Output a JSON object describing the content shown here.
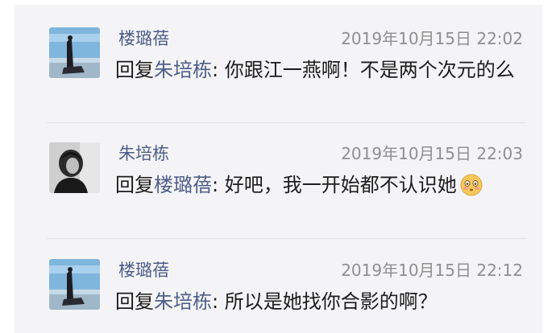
{
  "comments": [
    {
      "author": "楼璐蓓",
      "timestamp": "2019年10月15日 22:02",
      "reply_prefix": "回复",
      "reply_to": "朱培栋",
      "text": ": 你跟江一燕啊！不是两个次元的么"
    },
    {
      "author": "朱培栋",
      "timestamp": "2019年10月15日 22:03",
      "reply_prefix": "回复",
      "reply_to": "楼璐蓓",
      "text": ": 好吧，我一开始都不认识她",
      "emoji": "shy-face-emoji"
    },
    {
      "author": "楼璐蓓",
      "timestamp": "2019年10月15日 22:12",
      "reply_prefix": "回复",
      "reply_to": "朱培栋",
      "text": ": 所以是她找你合影的啊？"
    }
  ],
  "colors": {
    "background": "#f4f4f6",
    "name": "#4e5e89",
    "timestamp": "#8f8f8f",
    "text": "#1c1c1c"
  }
}
